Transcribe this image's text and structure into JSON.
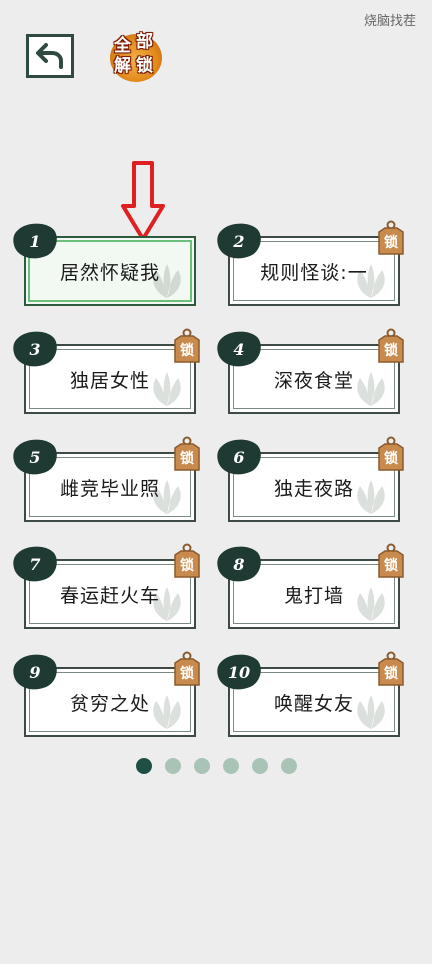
{
  "header": {
    "title": "烧脑找茬"
  },
  "unlock_all": {
    "chars": [
      "全",
      "部",
      "解",
      "锁"
    ]
  },
  "lock_label": "锁",
  "levels": [
    {
      "num": "1",
      "name": "居然怀疑我",
      "locked": false
    },
    {
      "num": "2",
      "name": "规则怪谈:一",
      "locked": true
    },
    {
      "num": "3",
      "name": "独居女性",
      "locked": true
    },
    {
      "num": "4",
      "name": "深夜食堂",
      "locked": true
    },
    {
      "num": "5",
      "name": "雌竞毕业照",
      "locked": true
    },
    {
      "num": "6",
      "name": "独走夜路",
      "locked": true
    },
    {
      "num": "7",
      "name": "春运赶火车",
      "locked": true
    },
    {
      "num": "8",
      "name": "鬼打墙",
      "locked": true
    },
    {
      "num": "9",
      "name": "贫穷之处",
      "locked": true
    },
    {
      "num": "10",
      "name": "唤醒女友",
      "locked": true
    }
  ],
  "pagination": {
    "pages": 6,
    "current": 1
  },
  "colors": {
    "accent": "#1f4f44",
    "lock": "#c98a4e",
    "arrow": "#e02020"
  }
}
